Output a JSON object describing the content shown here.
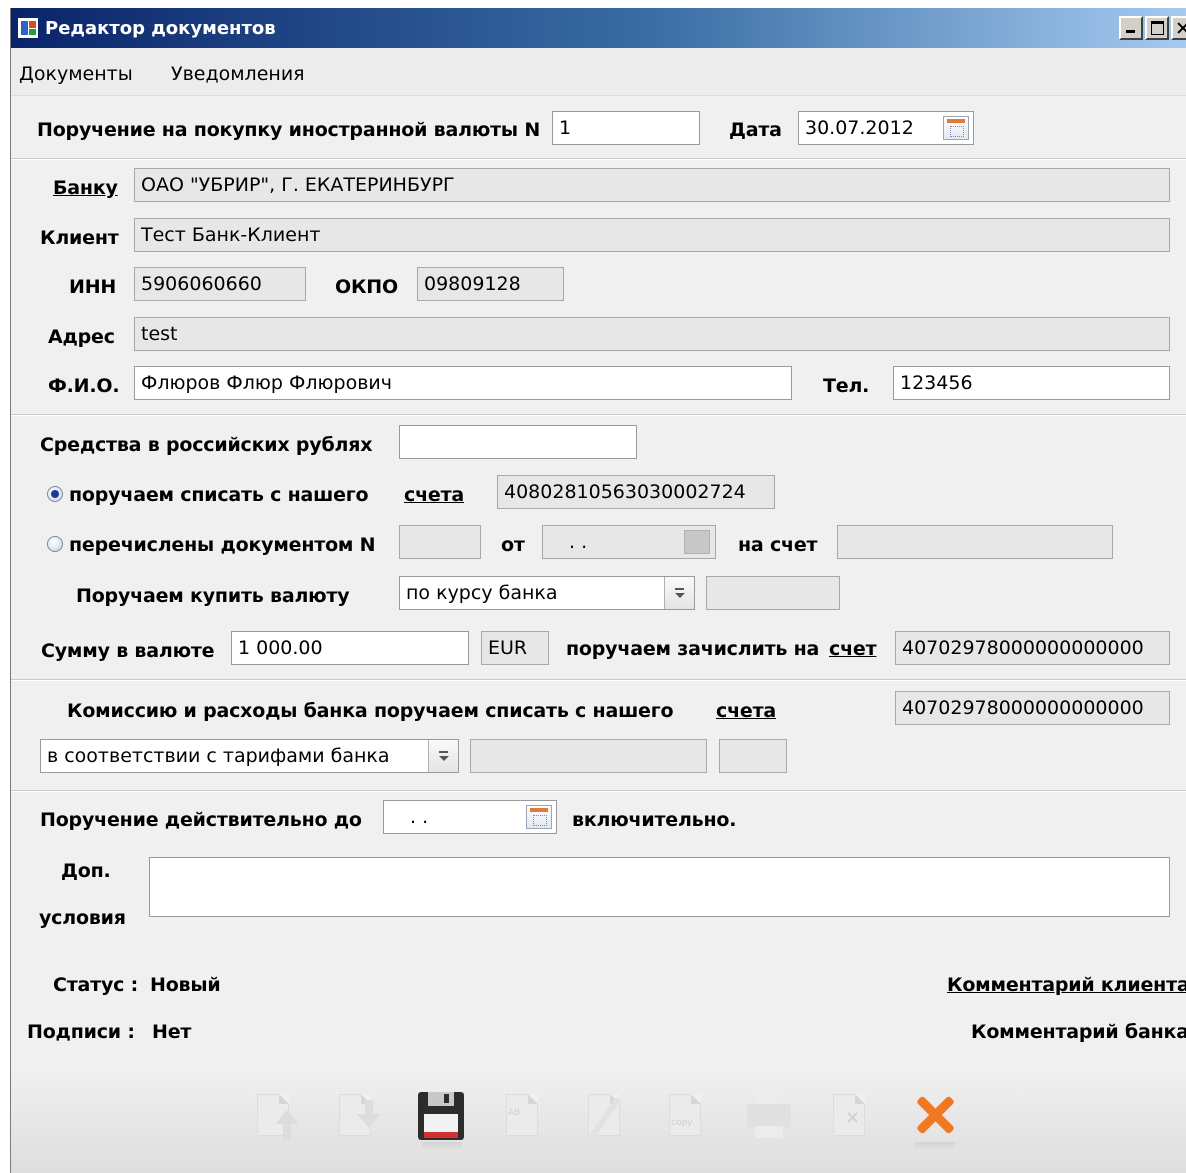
{
  "window": {
    "title": "Редактор документов"
  },
  "menu": [
    "Документы",
    "Уведомления"
  ],
  "header": {
    "order_label": "Поручение на покупку иностранной валюты N",
    "order_number": "1",
    "date_label": "Дата",
    "date_value": "30.07.2012"
  },
  "client_block": {
    "bank_label": "Банку",
    "bank_value": "ОАО \"УБРИР\", Г. ЕКАТЕРИНБУРГ",
    "client_label": "Клиент",
    "client_value": "Тест Банк-Клиент",
    "inn_label": "ИНН",
    "inn_value": "5906060660",
    "okpo_label": "ОКПО",
    "okpo_value": "09809128",
    "address_label": "Адрес",
    "address_value": "test",
    "fio_label": "Ф.И.О.",
    "fio_value": "Флюров Флюр Флюрович",
    "phone_label": "Тел.",
    "phone_value": "123456"
  },
  "funds_block": {
    "rub_label": "Средства в российских рублях",
    "rub_value": "",
    "radio1_label": "поручаем списать с нашего",
    "radio1_selected": true,
    "account_link": "счета",
    "account_value": "40802810563030002724",
    "radio2_label": "перечислены документом N",
    "radio2_selected": false,
    "doc_number_value": "",
    "from_label": "от",
    "from_date_value": " .  .",
    "to_account_label": "на счет",
    "to_account_value": "",
    "buy_label": "Поручаем купить валюту",
    "buy_select_value": "по курсу банка",
    "buy_rate_value": "",
    "sum_label": "Сумму в валюте",
    "sum_value": "1 000.00",
    "currency_value": "EUR",
    "credit_label": "поручаем зачислить на",
    "credit_link": "счет",
    "credit_account_value": "40702978000000000000"
  },
  "commission_block": {
    "label": "Комиссию и расходы банка поручаем списать с нашего",
    "account_link": "счета",
    "account_value": "40702978000000000000",
    "select_value": "в соответствии с тарифами банка",
    "extra_field_1": "",
    "extra_field_2": ""
  },
  "validity_block": {
    "valid_label": "Поручение действительно до",
    "valid_date_value": " .  .",
    "inclusive_label": "включительно.",
    "conditions_label_1": "Доп.",
    "conditions_label_2": "условия",
    "conditions_value": ""
  },
  "status_block": {
    "status_label": "Статус :",
    "status_value": "Новый",
    "signatures_label": "Подписи :",
    "signatures_value": "Нет",
    "client_comment_link": "Комментарий клиента",
    "bank_comment_label": "Комментарий банка"
  },
  "toolbar": {
    "icons": [
      "import-icon",
      "export-icon",
      "save-icon",
      "template-icon",
      "edit-icon",
      "copy-icon",
      "print-icon",
      "delete-icon",
      "close-icon"
    ],
    "template_icon_text": "AB",
    "copy_icon_text": "copy",
    "delete_icon_text": "✕"
  },
  "colors": {
    "title_bar": "#0a246a",
    "readonly_field": "#e7e7e7",
    "close_accent": "#f07820",
    "save_stripe": "#d03030"
  }
}
